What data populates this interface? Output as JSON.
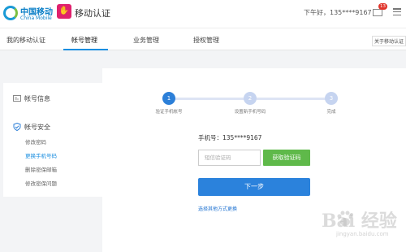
{
  "brand": {
    "name_cn": "中国移动",
    "name_en": "China Mobile",
    "app_icon": "hand-icon",
    "app_title": "移动认证"
  },
  "header": {
    "greeting": "下午好，135****9167",
    "mail_badge": "13",
    "menu_icon": "menu-icon"
  },
  "nav": {
    "items": [
      "我的移动认证",
      "帐号管理",
      "业务管理",
      "授权管理"
    ],
    "active": "帐号管理",
    "right_link": "关于移动认证"
  },
  "sidebar": {
    "section1": "帐号信息",
    "section2": "帐号安全",
    "sub_items": [
      "修改密码",
      "更换手机号码",
      "删除密保邮箱",
      "修改密保问题"
    ],
    "active_sub": "更换手机号码"
  },
  "steps": [
    {
      "num": "1",
      "label": "验证手机帐号"
    },
    {
      "num": "2",
      "label": "设置新手机号码"
    },
    {
      "num": "3",
      "label": "完成"
    }
  ],
  "form": {
    "phone_label": "手机号：135****9167",
    "sms_placeholder": "短信验证码",
    "get_code": "获取验证码",
    "next": "下一步",
    "other_method": "选择其他方式更换"
  },
  "watermark": {
    "text": "Bai 经验",
    "url": "jingyan.baidu.com"
  },
  "colors": {
    "primary": "#2b82dc",
    "green": "#5fb94a",
    "badge": "#e1332a",
    "brand_pink": "#e0216d"
  }
}
